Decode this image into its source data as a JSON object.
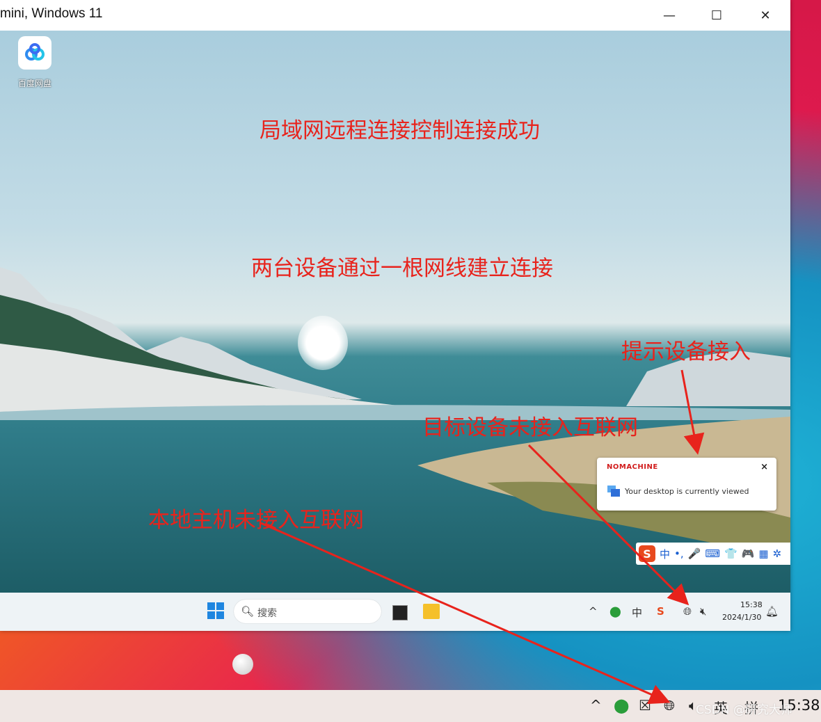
{
  "window": {
    "title": "mini, Windows 11",
    "minimize": "—",
    "maximize": "☐",
    "close": "✕"
  },
  "desktop": {
    "icon_label": "百度网盘"
  },
  "annotations": {
    "success": "局域网远程连接控制连接成功",
    "cable": "两台设备通过一根网线建立连接",
    "prompt": "提示设备接入",
    "target_offline": "目标设备未接入互联网",
    "local_offline": "本地主机未接入互联网"
  },
  "notification": {
    "brand": "NOMACHINE",
    "close": "×",
    "message": "Your desktop is currently viewed"
  },
  "ime_toolbar": {
    "logo": "S",
    "mode": "中",
    "punct": "•,",
    "mic": "🎤",
    "keyboard": "⌨",
    "skin": "👕",
    "game": "🎮",
    "apps": "▦",
    "settings": "✲"
  },
  "remote_taskbar": {
    "search_placeholder": "搜索",
    "chevron": "^",
    "ime_indicator": "中",
    "time": "15:38",
    "date": "2024/1/30"
  },
  "host_taskbar": {
    "chevron": "^",
    "ime_mode": "英",
    "layout": "拼",
    "time": "15:38"
  },
  "watermark": "CSDN @研究大师"
}
